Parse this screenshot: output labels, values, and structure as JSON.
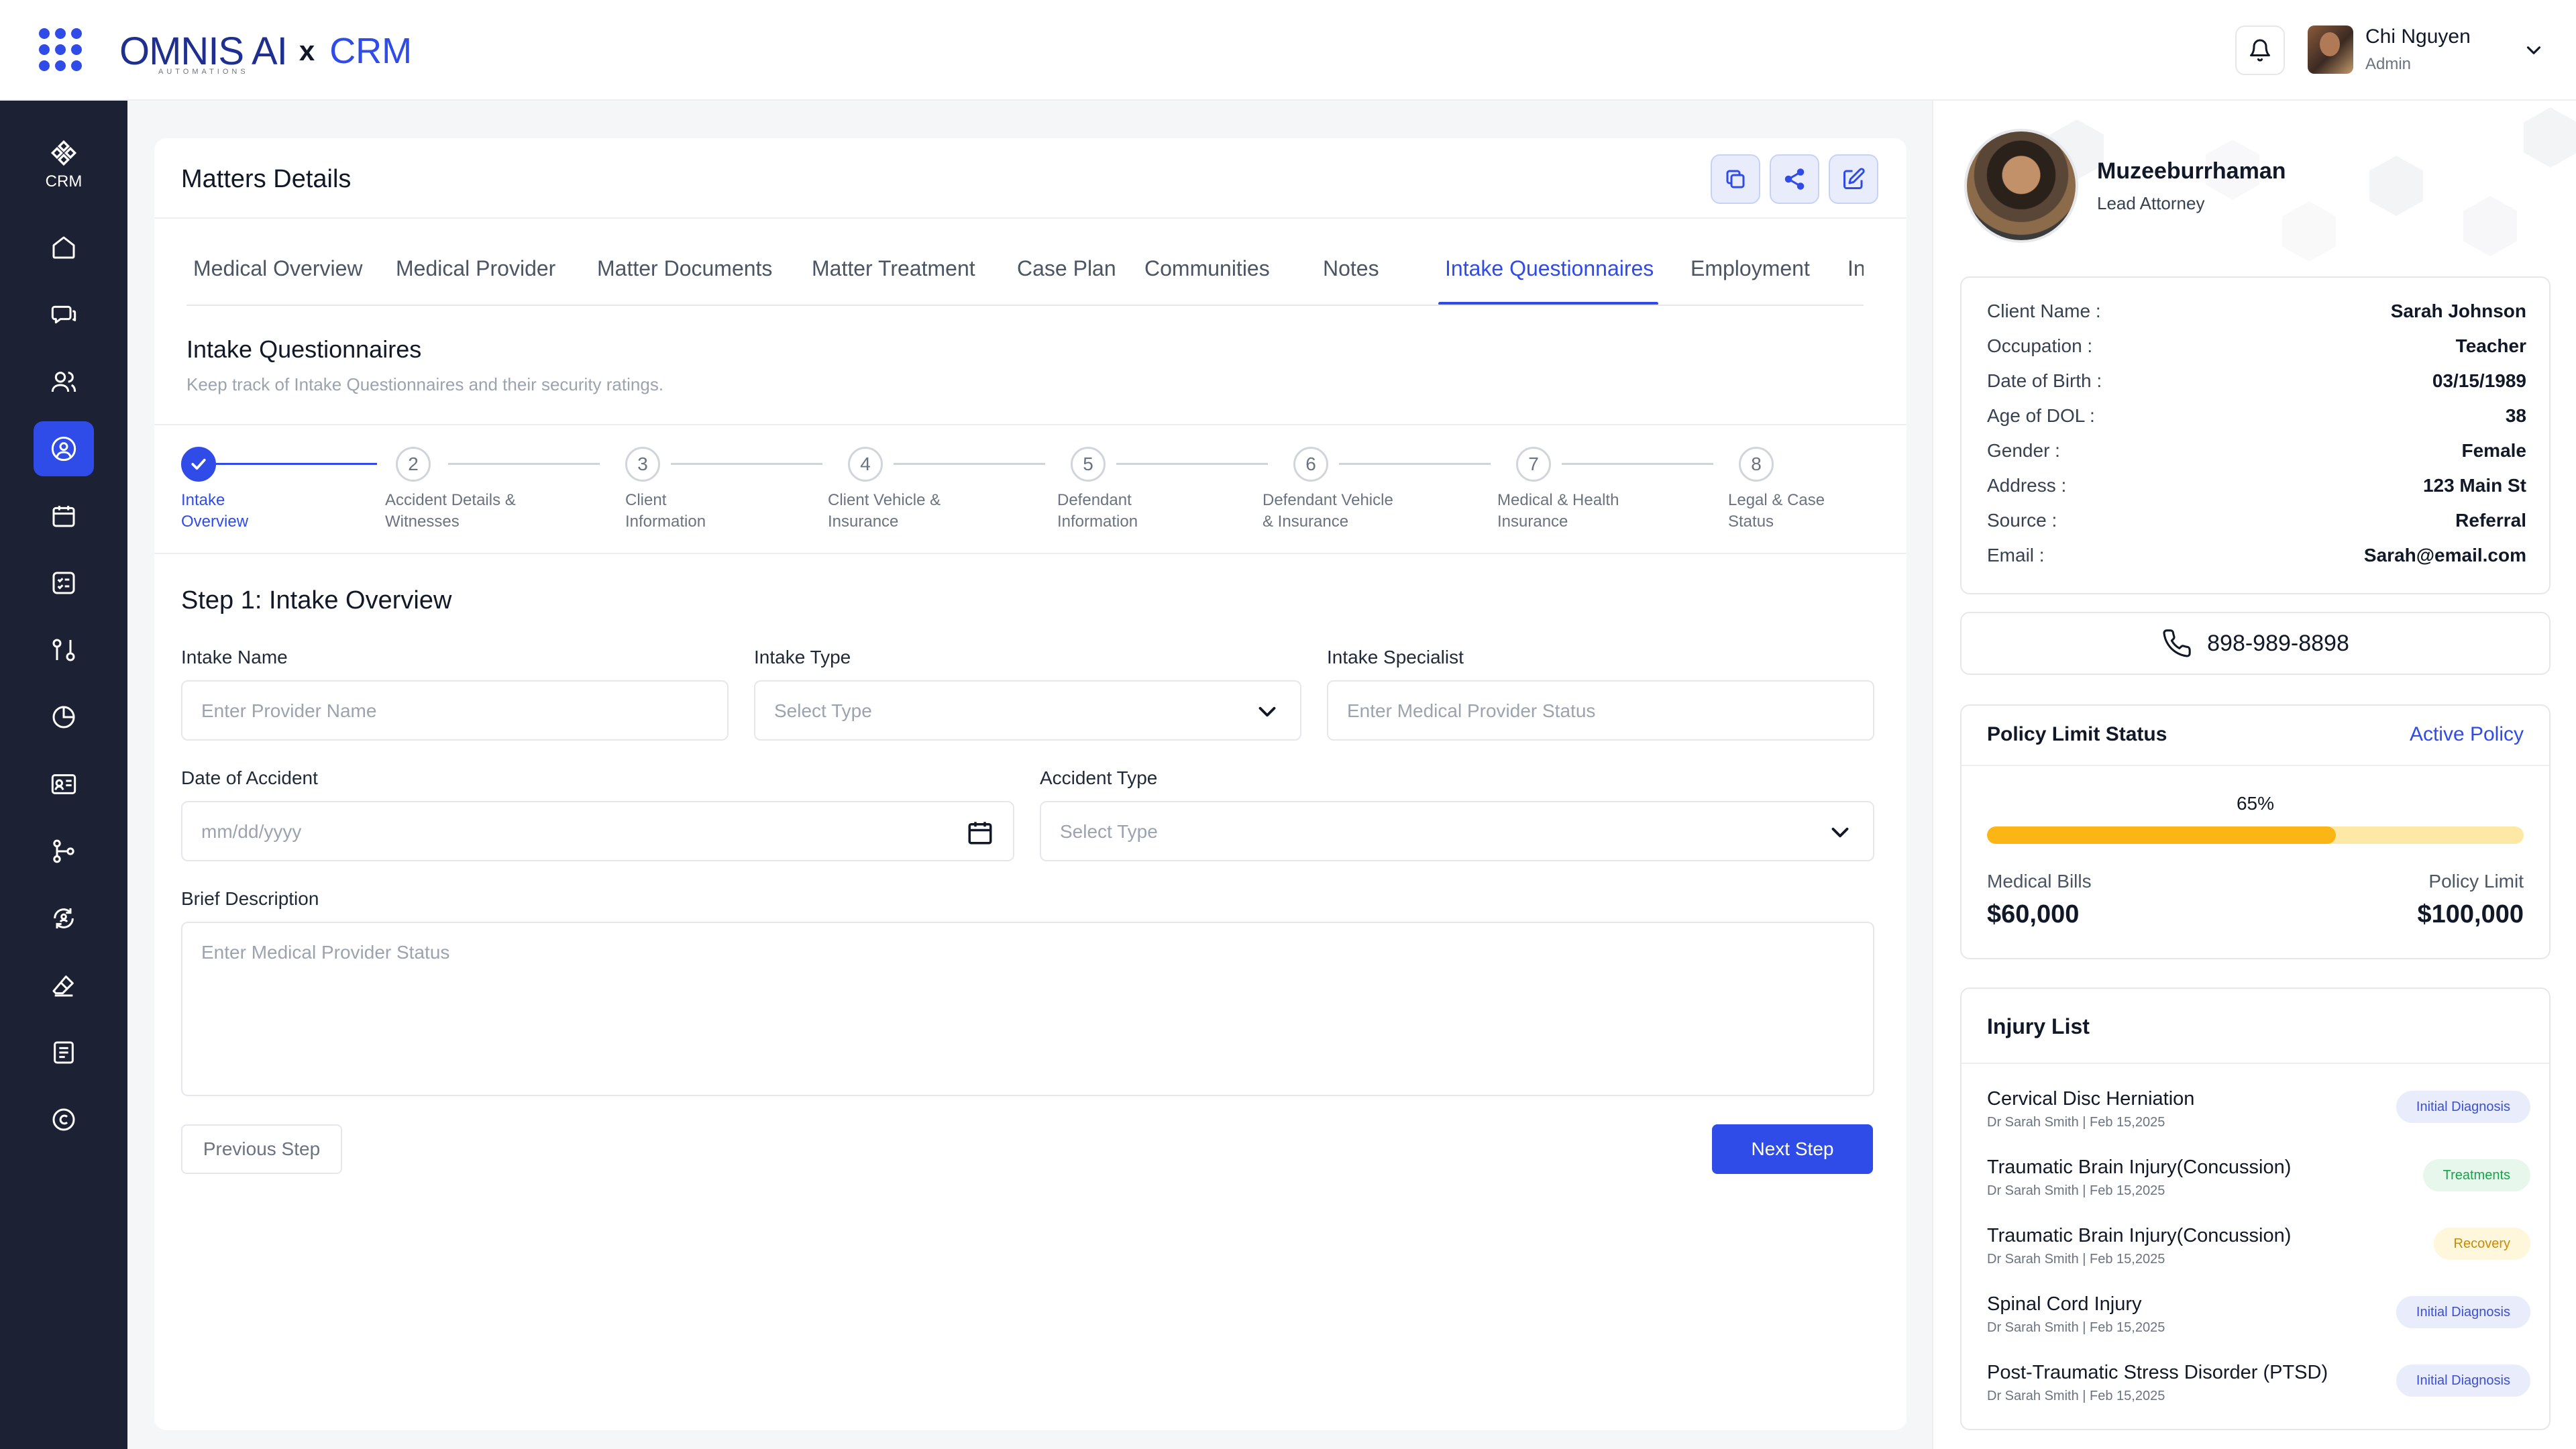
{
  "brand": {
    "logo_text": "OMNIS AI",
    "logo_sub": "AUTOMATIONS",
    "separator": "x",
    "product": "CRM"
  },
  "user": {
    "name": "Chi Nguyen",
    "role": "Admin"
  },
  "sidebar": {
    "brand_label": "CRM",
    "items": [
      {
        "icon": "home-icon"
      },
      {
        "icon": "chat-icon"
      },
      {
        "icon": "users-icon"
      },
      {
        "icon": "user-circle-icon",
        "active": true
      },
      {
        "icon": "calendar-icon"
      },
      {
        "icon": "checklist-icon"
      },
      {
        "icon": "git-compare-icon"
      },
      {
        "icon": "pie-chart-icon"
      },
      {
        "icon": "id-card-icon"
      },
      {
        "icon": "git-branch-icon"
      },
      {
        "icon": "refresh-user-icon"
      },
      {
        "icon": "eraser-icon"
      },
      {
        "icon": "notes-icon"
      },
      {
        "icon": "copyright-icon"
      }
    ]
  },
  "main": {
    "title": "Matters Details",
    "tabs": [
      {
        "label": "Medical Overview"
      },
      {
        "label": "Medical Provider"
      },
      {
        "label": "Matter Documents"
      },
      {
        "label": "Matter Treatment"
      },
      {
        "label": "Case Plan"
      },
      {
        "label": "Communities"
      },
      {
        "label": "Notes"
      },
      {
        "label": "Intake Questionnaires",
        "active": true
      },
      {
        "label": "Employment"
      },
      {
        "label": "Insura"
      }
    ],
    "section_title": "Intake Questionnaires",
    "section_subtitle": "Keep track of Intake Questionnaires and their security ratings.",
    "steps": [
      {
        "number": "1",
        "label_line1": "Intake",
        "label_line2": "Overview",
        "active": true
      },
      {
        "number": "2",
        "label_line1": "Accident Details &",
        "label_line2": "Witnesses"
      },
      {
        "number": "3",
        "label_line1": "Client",
        "label_line2": "Information"
      },
      {
        "number": "4",
        "label_line1": "Client Vehicle &",
        "label_line2": "Insurance"
      },
      {
        "number": "5",
        "label_line1": "Defendant",
        "label_line2": "Information"
      },
      {
        "number": "6",
        "label_line1": "Defendant Vehicle",
        "label_line2": "& Insurance"
      },
      {
        "number": "7",
        "label_line1": "Medical & Health",
        "label_line2": "Insurance"
      },
      {
        "number": "8",
        "label_line1": "Legal & Case",
        "label_line2": "Status"
      }
    ],
    "form": {
      "step_title": "Step 1: Intake Overview",
      "intake_name": {
        "label": "Intake Name",
        "placeholder": "Enter Provider Name"
      },
      "intake_type": {
        "label": "Intake Type",
        "placeholder": "Select Type"
      },
      "intake_specialist": {
        "label": "Intake Specialist",
        "placeholder": "Enter Medical Provider Status"
      },
      "date_of_accident": {
        "label": "Date of Accident",
        "placeholder": "mm/dd/yyyy"
      },
      "accident_type": {
        "label": "Accident Type",
        "placeholder": "Select Type"
      },
      "brief_description": {
        "label": "Brief Description",
        "placeholder": "Enter Medical Provider Status"
      },
      "prev_label": "Previous Step",
      "next_label": "Next Step"
    }
  },
  "profile": {
    "name": "Muzeeburrhaman",
    "role": "Lead Attorney",
    "details": [
      {
        "key": "Client Name :",
        "value": "Sarah Johnson"
      },
      {
        "key": "Occupation :",
        "value": "Teacher"
      },
      {
        "key": "Date of Birth :",
        "value": "03/15/1989"
      },
      {
        "key": "Age of DOL :",
        "value": "38"
      },
      {
        "key": "Gender :",
        "value": "Female"
      },
      {
        "key": "Address :",
        "value": "123 Main St"
      },
      {
        "key": "Source :",
        "value": "Referral"
      },
      {
        "key": "Email :",
        "value": "Sarah@email.com"
      }
    ],
    "phone": "898-989-8898"
  },
  "policy": {
    "title": "Policy Limit Status",
    "status_link": "Active Policy",
    "percent_label": "65%",
    "percent": 65,
    "medical_bills_label": "Medical Bills",
    "medical_bills_value": "$60,000",
    "policy_limit_label": "Policy Limit",
    "policy_limit_value": "$100,000",
    "colors": {
      "fill": "#fbb515",
      "track": "#fde8a6"
    }
  },
  "injuries": {
    "title": "Injury List",
    "items": [
      {
        "name": "Cervical Disc Herniation",
        "meta": "Dr Sarah Smith | Feb 15,2025",
        "badge": "Initial Diagnosis",
        "badge_color": "#3b4fd6",
        "badge_bg": "#e9edfb"
      },
      {
        "name": "Traumatic Brain Injury(Concussion)",
        "meta": "Dr Sarah Smith | Feb 15,2025",
        "badge": "Treatments",
        "badge_color": "#16a34a",
        "badge_bg": "#e7f7ec"
      },
      {
        "name": "Traumatic Brain Injury(Concussion)",
        "meta": "Dr Sarah Smith | Feb 15,2025",
        "badge": "Recovery",
        "badge_color": "#ca8a04",
        "badge_bg": "#fef7dc"
      },
      {
        "name": "Spinal Cord Injury",
        "meta": "Dr Sarah Smith | Feb 15,2025",
        "badge": "Initial Diagnosis",
        "badge_color": "#3b4fd6",
        "badge_bg": "#e9edfb"
      },
      {
        "name": "Post-Traumatic Stress Disorder (PTSD)",
        "meta": "Dr Sarah Smith | Feb 15,2025",
        "badge": "Initial Diagnosis",
        "badge_color": "#3b4fd6",
        "badge_bg": "#e9edfb"
      }
    ]
  }
}
